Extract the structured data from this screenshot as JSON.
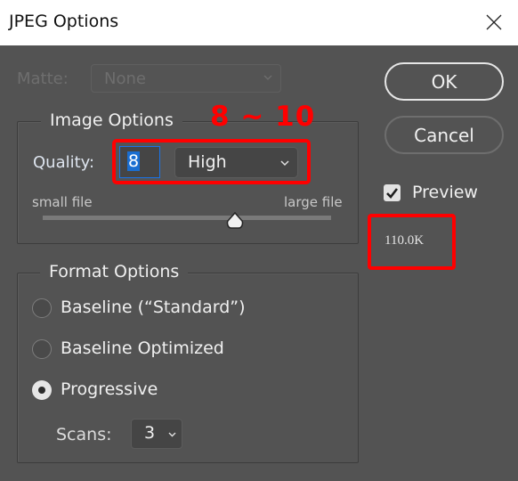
{
  "window": {
    "title": "JPEG Options",
    "close_icon": "close-icon"
  },
  "matte": {
    "label": "Matte:",
    "value": "None",
    "disabled": true
  },
  "image_options": {
    "legend": "Image Options",
    "quality_label": "Quality:",
    "quality_value": "8",
    "quality_preset": "High",
    "small_file_label": "small file",
    "large_file_label": "large file",
    "quality_slider": {
      "value": 8,
      "min": 0,
      "max": 12
    }
  },
  "annotation": {
    "text": "8 ~ 10",
    "color": "#ff0000"
  },
  "format_options": {
    "legend": "Format Options",
    "options": [
      {
        "label": "Baseline (“Standard”)",
        "selected": false
      },
      {
        "label": "Baseline Optimized",
        "selected": false
      },
      {
        "label": "Progressive",
        "selected": true
      }
    ],
    "scans_label": "Scans:",
    "scans_value": "3"
  },
  "actions": {
    "ok_label": "OK",
    "cancel_label": "Cancel"
  },
  "preview": {
    "label": "Preview",
    "checked": true,
    "file_size": "110.0K"
  },
  "colors": {
    "dialog_bg": "#535353",
    "accent_blue": "#1a73e8",
    "annotation_red": "#ff0000"
  }
}
